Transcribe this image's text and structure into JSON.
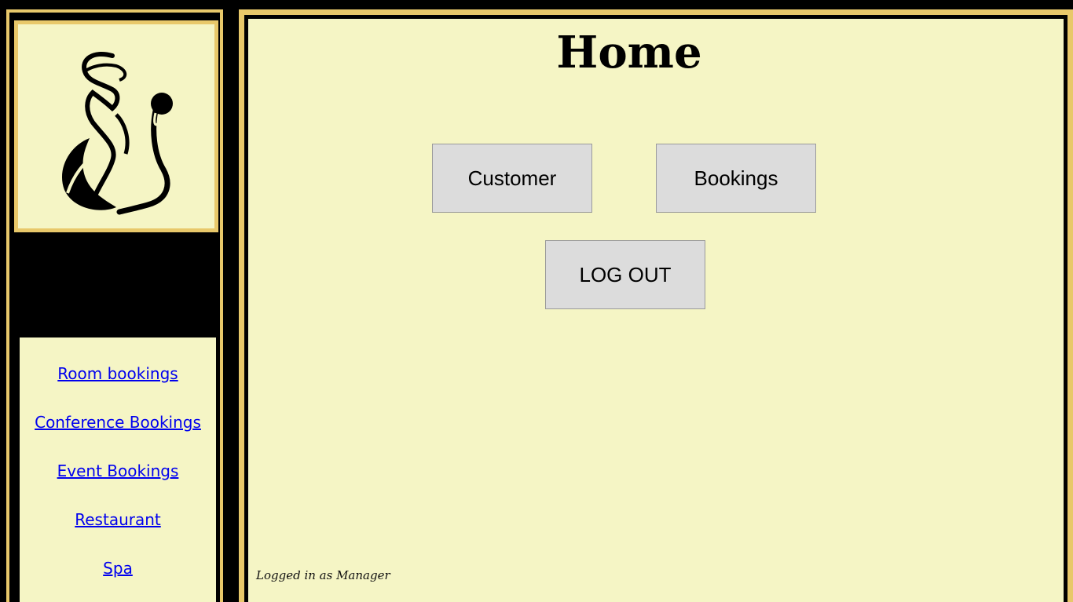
{
  "sidebar": {
    "logo_icon": "swan-monogram-logo",
    "nav_items": [
      {
        "label": "Room bookings"
      },
      {
        "label": "Conference Bookings"
      },
      {
        "label": "Event Bookings"
      },
      {
        "label": "Restaurant"
      },
      {
        "label": "Spa"
      }
    ]
  },
  "main": {
    "title": "Home",
    "buttons": {
      "customer": "Customer",
      "bookings": "Bookings",
      "logout": "LOG OUT"
    },
    "status_text": "Logged in as Manager"
  },
  "colors": {
    "background": "#000000",
    "panel": "#f5f5c5",
    "border_gold": "#e8c86a",
    "button": "#dcdcdc",
    "link": "#0000ee"
  }
}
